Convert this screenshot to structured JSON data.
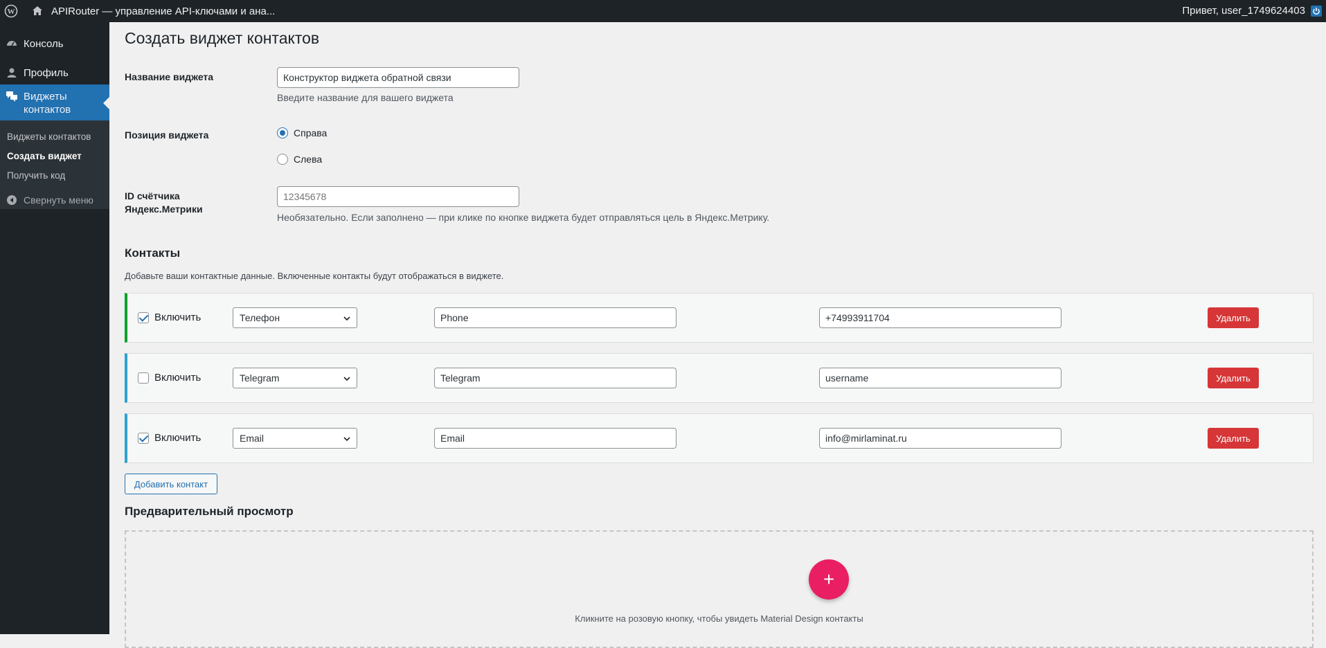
{
  "adminbar": {
    "site_title": "APIRouter — управление API-ключами и ана...",
    "greeting": "Привет, user_1749624403"
  },
  "sidebar": {
    "items": [
      {
        "label": "Консоль",
        "icon": "dashboard-icon"
      },
      {
        "label": "Профиль",
        "icon": "user-icon"
      },
      {
        "label": "Виджеты контактов",
        "icon": "comments-icon"
      }
    ],
    "submenu": [
      {
        "label": "Виджеты контактов"
      },
      {
        "label": "Создать виджет"
      },
      {
        "label": "Получить код"
      }
    ],
    "collapse_label": "Свернуть меню"
  },
  "page": {
    "title": "Создать виджет контактов",
    "widget_name": {
      "label": "Название виджета",
      "value": "Конструктор виджета обратной связи",
      "description": "Введите название для вашего виджета"
    },
    "position": {
      "label": "Позиция виджета",
      "options": [
        "Справа",
        "Слева"
      ],
      "selected": "Справа"
    },
    "metrika": {
      "label_line1": "ID счётчика",
      "label_line2": "Яндекс.Метрики",
      "placeholder": "12345678",
      "description": "Необязательно. Если заполнено — при клике по кнопке виджета будет отправляться цель в Яндекс.Метрику."
    },
    "contacts": {
      "title": "Контакты",
      "description": "Добавьте ваши контактные данные. Включенные контакты будут отображаться в виджете.",
      "enable_label": "Включить",
      "delete_label": "Удалить",
      "rows": [
        {
          "enabled": true,
          "type": "Телефон",
          "name": "Phone",
          "value": "+74993911704",
          "accent": "#00a32a"
        },
        {
          "enabled": false,
          "type": "Telegram",
          "name": "Telegram",
          "value": "username",
          "accent": "#2ea2cc"
        },
        {
          "enabled": true,
          "type": "Email",
          "name": "Email",
          "value": "info@mirlaminat.ru",
          "accent": "#2ea2cc"
        }
      ],
      "add_label": "Добавить контакт"
    },
    "preview": {
      "title": "Предварительный просмотр",
      "fab_symbol": "+",
      "hint": "Кликните на розовую кнопку, чтобы увидеть Material Design контакты"
    }
  },
  "colors": {
    "admin_bg": "#1d2327",
    "accent": "#2271b1",
    "delete": "#d63638",
    "fab": "#e91e63"
  }
}
